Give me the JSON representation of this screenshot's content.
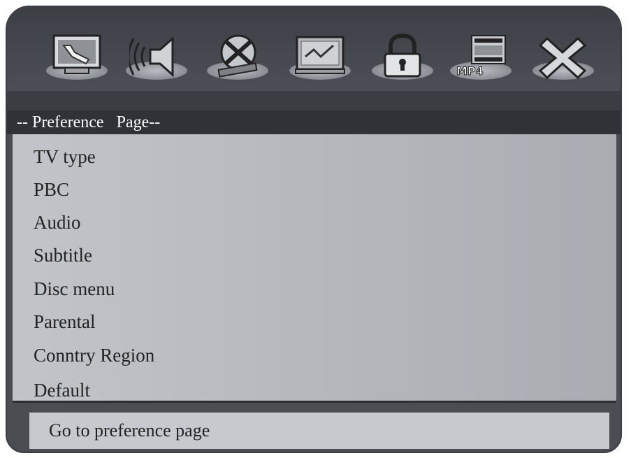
{
  "toolbar": {
    "icons": [
      {
        "name": "general-setup-icon"
      },
      {
        "name": "audio-setup-icon"
      },
      {
        "name": "video-setup-icon"
      },
      {
        "name": "preference-setup-icon"
      },
      {
        "name": "password-setup-icon"
      },
      {
        "name": "mp4-setup-icon"
      },
      {
        "name": "exit-icon"
      }
    ]
  },
  "page_title": "-- Preference   Page--",
  "menu": {
    "items": [
      {
        "label": "TV type"
      },
      {
        "label": "PBC"
      },
      {
        "label": "Audio"
      },
      {
        "label": "Subtitle"
      },
      {
        "label": "Disc menu"
      },
      {
        "label": "Parental"
      },
      {
        "label": "Conntry Region"
      },
      {
        "label": "Default"
      }
    ]
  },
  "status": {
    "text": "Go to preference page"
  }
}
